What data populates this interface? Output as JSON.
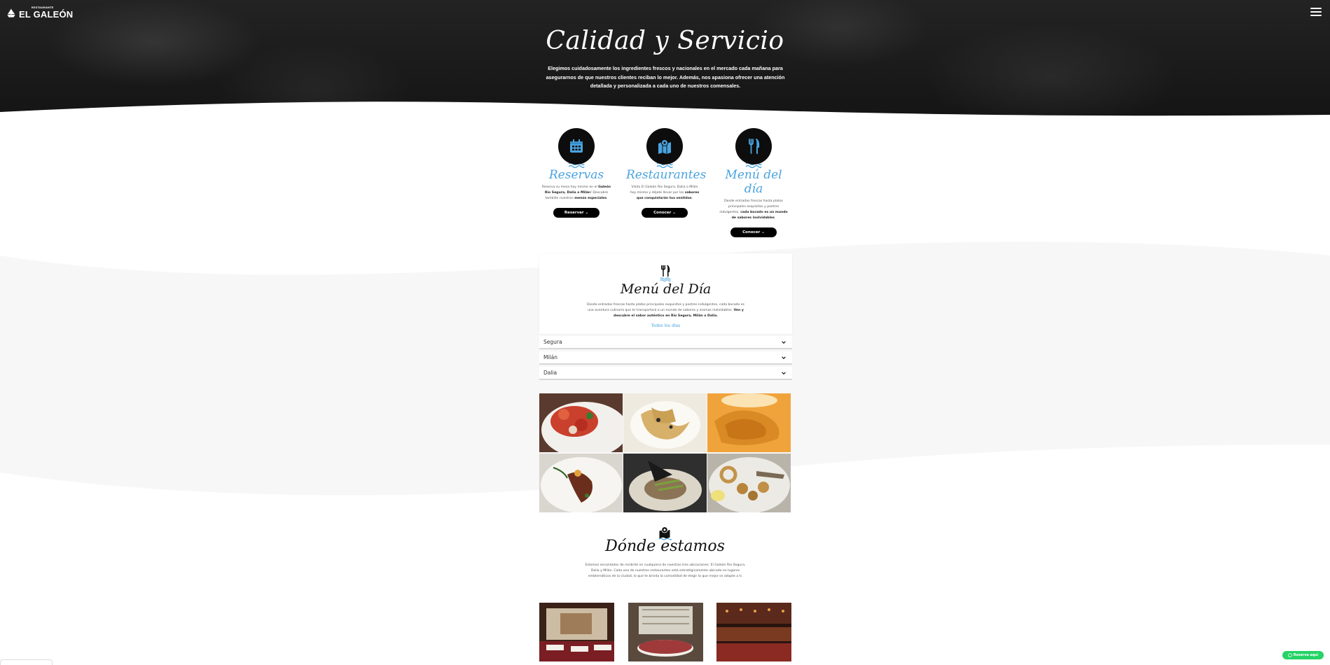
{
  "header": {
    "logo_small": "RESTAURANTE",
    "logo_name": "EL GALEÓN",
    "menu_icon": "hamburger-menu-icon"
  },
  "hero": {
    "title": "Calidad y Servicio",
    "text": "Elegimos cuidadosamente los ingredientes frescos y nacionales en el mercado cada mañana para asegurarnos de que nuestros clientes reciban lo mejor. Además, nos apasiona ofrecer una atención detallada y personalizada a cada uno de nuestros comensales."
  },
  "features": [
    {
      "icon": "calendar-icon",
      "title": "Reservas",
      "text_a": "Reserva su mesa hoy mismo en el ",
      "text_b": "Galeón Rio Segura, Dalia o Milán",
      "text_c": "! Descubre también nuestros ",
      "text_d": "menús especiales",
      "text_e": ".",
      "button": "Reservar ⌄"
    },
    {
      "icon": "map-pin-icon",
      "title": "Restaurantes",
      "text_a": "Visita El Galeón Rio Segura, Dalia o Milán hoy mismo y déjate llevar por los ",
      "text_b": "sabores que conquistarán tus sentidos",
      "text_c": ".",
      "button": "Conocer ⌄"
    },
    {
      "icon": "fork-knife-icon",
      "title": "Menú del día",
      "text_a": "Desde entradas frescas hasta platos principales exquisitos y postres indulgentes, ",
      "text_b": "cada bocado es un mundo de sabores inolvidables",
      "text_c": ".",
      "button": "Conocer ⌄"
    }
  ],
  "menu": {
    "title": "Menú del Día",
    "text_a": "Desde entradas frescas hasta platos principales exquisitos y postres indulgentes, cada bocado es una aventura culinaria que te transportará a un mundo de sabores y aromas inolvidables. ",
    "text_b": "Ven y descubre el sabor auténtico en Rio Segura, Milán o Dalia.",
    "link": "Todos los días",
    "accordion": [
      "Segura",
      "Milán",
      "Dalia"
    ]
  },
  "donde": {
    "title": "Dónde estamos",
    "text": "Estamos encantados de recibirte en cualquiera de nuestras tres ubicaciones: El Galeón Rio Segura, Dalia y Milán. Cada uno de nuestros restaurantes está estratégicamente ubicado en lugares emblemáticos de la ciudad, lo que te brinda la comodidad de elegir la que mejor se adapte a ti."
  },
  "whatsapp": {
    "label": "Reserva aquí",
    "icon": "whatsapp-icon"
  },
  "colors": {
    "accent": "#4aa3df",
    "dark": "#0d0d0d",
    "whatsapp": "#25d366"
  }
}
